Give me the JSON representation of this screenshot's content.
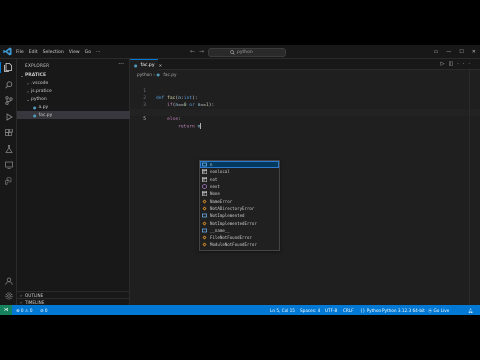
{
  "titlebar": {
    "menu": [
      "File",
      "Edit",
      "Selection",
      "View",
      "Go",
      "···"
    ],
    "search_text": "python"
  },
  "sidebar": {
    "title": "EXPLORER",
    "root": "PRATICE",
    "items": [
      {
        "label": ".vscode",
        "type": "folder"
      },
      {
        "label": "js.pratice",
        "type": "folder"
      },
      {
        "label": "python",
        "type": "folder-open"
      },
      {
        "label": "a.py",
        "type": "file"
      },
      {
        "label": "fac.py",
        "type": "file"
      }
    ],
    "outline": "OUTLINE",
    "timeline": "TIMELINE"
  },
  "editor": {
    "tab": "fac.py",
    "breadcrumb": [
      "python",
      "fac.py"
    ],
    "line_numbers": [
      "1",
      "2",
      "3",
      "4",
      "5"
    ]
  },
  "suggestions": [
    {
      "label": "n",
      "kind": "variable"
    },
    {
      "label": "nonlocal",
      "kind": "keyword"
    },
    {
      "label": "not",
      "kind": "keyword"
    },
    {
      "label": "next",
      "kind": "function"
    },
    {
      "label": "None",
      "kind": "keyword"
    },
    {
      "label": "NameError",
      "kind": "class"
    },
    {
      "label": "NotADirectoryError",
      "kind": "class"
    },
    {
      "label": "NotImplemented",
      "kind": "variable"
    },
    {
      "label": "NotImplementedError",
      "kind": "class"
    },
    {
      "label": "__name__",
      "kind": "variable"
    },
    {
      "label": "FileNotFoundError",
      "kind": "class"
    },
    {
      "label": "ModuleNotFoundError",
      "kind": "class"
    }
  ],
  "statusbar": {
    "left": [
      "⊗ 0 ⚠ 0",
      "⊘ 0"
    ],
    "position": "Ln 5, Col 15",
    "spaces": "Spaces: 4",
    "encoding": "UTF-8",
    "eol": "CRLF",
    "language": "{} Python",
    "interpreter": "Python 3.12.3 64-bit",
    "golive": "⦿ Go Live"
  },
  "colors": {
    "accent": "#0078d4",
    "statusbar": "#0078d4",
    "remote": "#16825d",
    "selection": "#04395e"
  }
}
